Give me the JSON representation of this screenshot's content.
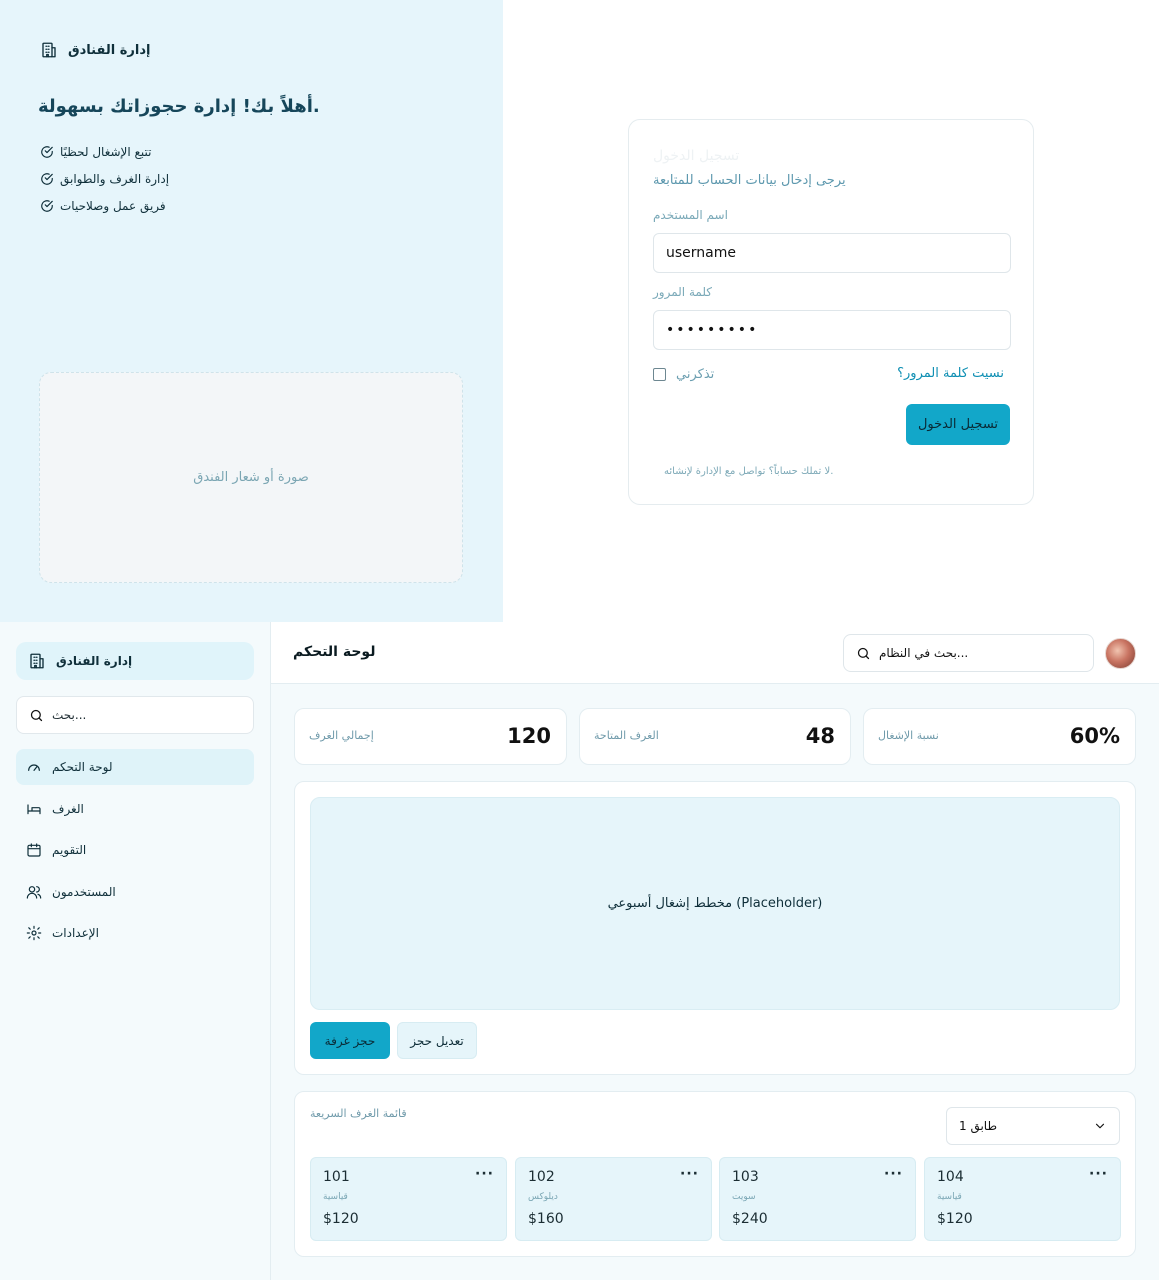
{
  "login": {
    "brand": "إدارة الفنادق",
    "welcome": "أهلاً بك! إدارة حجوزاتك بسهولة.",
    "features": [
      "تتبع الإشغال لحظيًا",
      "إدارة الغرف والطوابق",
      "فريق عمل وصلاحيات"
    ],
    "image_placeholder": "صورة أو شعار الفندق",
    "card": {
      "title": "تسجيل الدخول",
      "subtitle": "يرجى إدخال بيانات الحساب للمتابعة",
      "username_label": "اسم المستخدم",
      "username_value": "username",
      "password_label": "كلمة المرور",
      "password_value": "password1",
      "remember_label": "تذكرني",
      "forgot_link": "نسيت كلمة المرور؟",
      "submit_label": "تسجيل الدخول",
      "footer": "لا تملك حساباً؟ تواصل مع الإدارة لإنشائه."
    }
  },
  "dashboard": {
    "sidebar": {
      "brand": "إدارة الفنادق",
      "search_placeholder": "بحث...",
      "items": [
        {
          "label": "لوحة التحكم",
          "icon": "gauge-icon",
          "active": true
        },
        {
          "label": "الغرف",
          "icon": "bed-icon"
        },
        {
          "label": "التقويم",
          "icon": "calendar-icon"
        },
        {
          "label": "المستخدمون",
          "icon": "users-icon"
        },
        {
          "label": "الإعدادات",
          "icon": "gear-icon"
        }
      ]
    },
    "header": {
      "title": "لوحة التحكم",
      "search_placeholder": "بحث في النظام..."
    },
    "stats": [
      {
        "label": "إجمالي الغرف",
        "value": "120"
      },
      {
        "label": "الغرف المتاحة",
        "value": "48"
      },
      {
        "label": "نسبة الإشغال",
        "value": "60%"
      }
    ],
    "chart_placeholder": "مخطط إشغال أسبوعي (Placeholder)",
    "actions": {
      "book": "حجز غرفة",
      "edit": "تعديل حجز"
    },
    "rooms": {
      "title": "قائمة الغرف السريعة",
      "floor_selected": "طابق 1",
      "more_label": "···",
      "items": [
        {
          "number": "101",
          "type": "قياسية",
          "price": "$120"
        },
        {
          "number": "102",
          "type": "ديلوكس",
          "price": "$160"
        },
        {
          "number": "103",
          "type": "سويت",
          "price": "$240"
        },
        {
          "number": "104",
          "type": "قياسية",
          "price": "$120"
        }
      ]
    }
  },
  "colors": {
    "accent": "#12a7c9",
    "panel_tint": "#e6f5fb",
    "text_dark": "#0f2f3a",
    "text_muted": "#6f9aaa"
  }
}
